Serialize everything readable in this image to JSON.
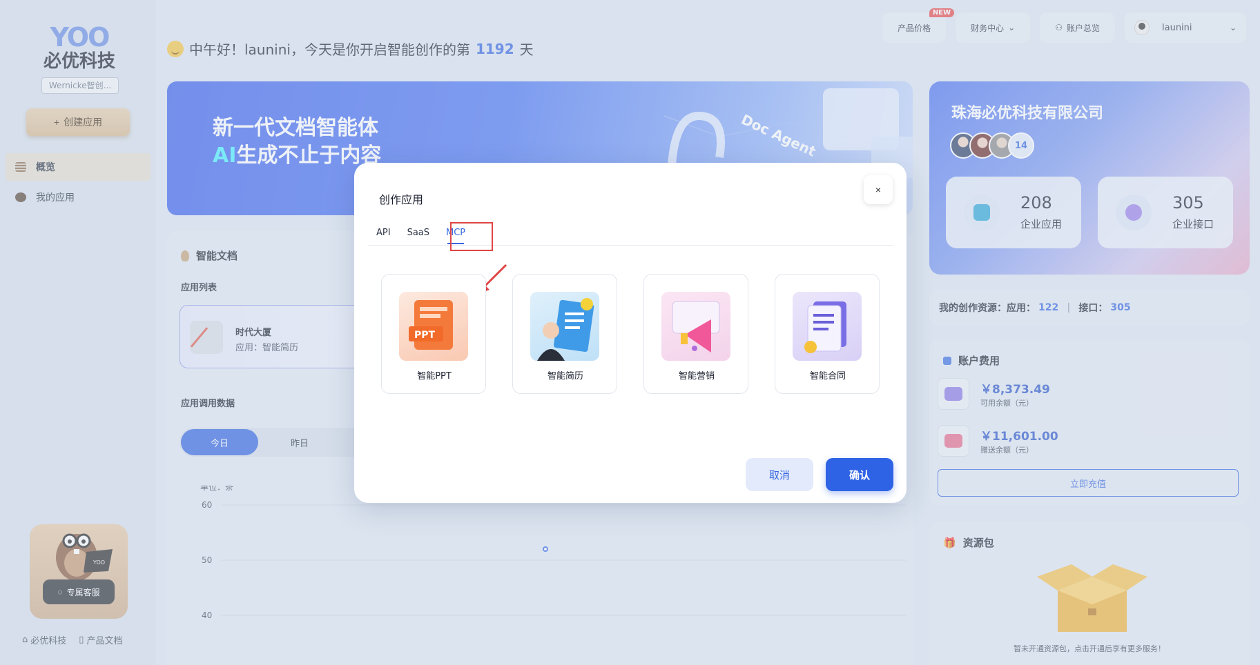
{
  "sidebar": {
    "logo_mark": "YOO",
    "logo_text": "必优科技",
    "logo_sub": "Wernicke智创...",
    "create_label": "创建应用",
    "nav": [
      {
        "label": "概览"
      },
      {
        "label": "我的应用"
      }
    ],
    "cs_label": "专属客服",
    "footer": [
      "必优科技",
      "产品文档"
    ]
  },
  "header": {
    "greeting_prefix": "中午好！launini，今天是你开启智能创作的第",
    "days": "1192",
    "greeting_suffix": "天",
    "price_label": "产品价格",
    "new_badge": "NEW",
    "finance_label": "财务中心",
    "account_label": "账户总览",
    "username": "launini"
  },
  "banner": {
    "line1": "新一代文档智能体",
    "line2_ai": "AI",
    "line2_rest": "生成不止于内容",
    "deco_text": "Doc Agent"
  },
  "main": {
    "section_title": "智能文档",
    "app_list_label": "应用列表",
    "app_card": {
      "name": "时代大厦",
      "type": "应用：智能简历"
    },
    "usage_label": "应用调用数据",
    "day_tabs": [
      "今日",
      "昨日"
    ]
  },
  "chart_data": {
    "type": "scatter",
    "title": "",
    "ylabel": "单位：条",
    "yticks": [
      60,
      50,
      40
    ],
    "ylim": [
      36,
      60
    ],
    "points": [
      {
        "y": 52
      }
    ]
  },
  "company": {
    "name": "珠海必优科技有限公司",
    "member_count": "14",
    "stats": [
      {
        "value": "208",
        "label": "企业应用"
      },
      {
        "value": "305",
        "label": "企业接口"
      }
    ]
  },
  "resources": {
    "label": "我的创作资源：应用：",
    "apps": "122",
    "sep": "接口：",
    "apis": "305"
  },
  "fees": {
    "title": "账户费用",
    "items": [
      {
        "amount": "￥8,373.49",
        "desc": "可用余额（元）"
      },
      {
        "amount": "￥11,601.00",
        "desc": "赠送余额（元）"
      }
    ],
    "recharge": "立即充值"
  },
  "package": {
    "title": "资源包",
    "empty": "暂未开通资源包，点击开通后享有更多服务！"
  },
  "modal": {
    "title": "创作应用",
    "close": "×",
    "tabs": [
      "API",
      "SaaS",
      "MCP"
    ],
    "active_tab": "MCP",
    "templates": [
      {
        "label": "智能PPT",
        "icon": "ppt-icon"
      },
      {
        "label": "智能简历",
        "icon": "resume-icon"
      },
      {
        "label": "智能营销",
        "icon": "megaphone-icon"
      },
      {
        "label": "智能合同",
        "icon": "contract-icon"
      }
    ],
    "cancel": "取消",
    "confirm": "确认",
    "ppt_badge": "PPT"
  },
  "colors": {
    "accent": "#3565e0",
    "highlight": "#e04545",
    "badge": "#e84a4a"
  }
}
